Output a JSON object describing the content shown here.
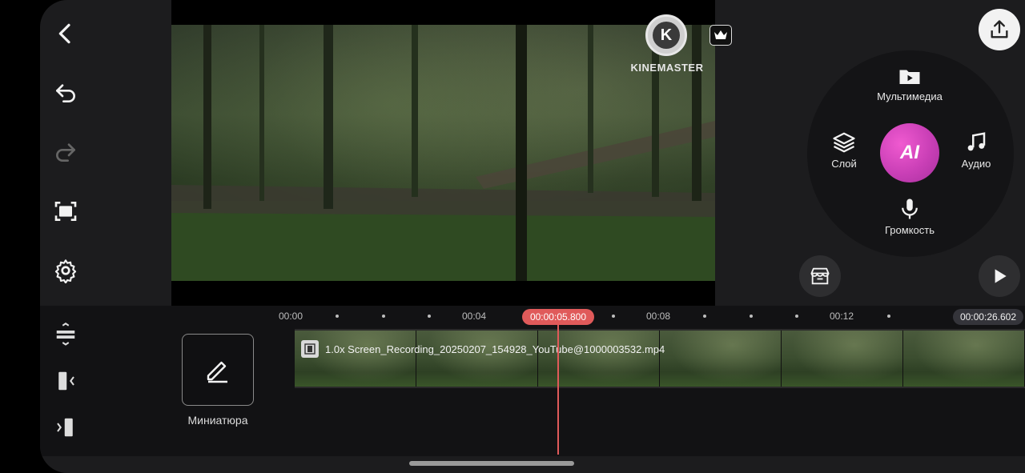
{
  "preview": {
    "watermark": "KINEMASTER"
  },
  "menu": {
    "media": "Мультимедиа",
    "layer": "Слой",
    "ai": "AI",
    "audio": "Аудио",
    "volume": "Громкость"
  },
  "timeline": {
    "ruler": [
      "00:00",
      "00:04",
      "00:08",
      "00:12"
    ],
    "playhead_time": "00:00:05.800",
    "end_time": "00:00:26.602",
    "clip_name": "1.0x Screen_Recording_20250207_154928_YouTube@1000003532.mp4",
    "thumbnail_label": "Миниатюра"
  },
  "colors": {
    "accent": "#e05a5a",
    "ai_button": "#c93fb6",
    "background": "#1c1c1e"
  }
}
